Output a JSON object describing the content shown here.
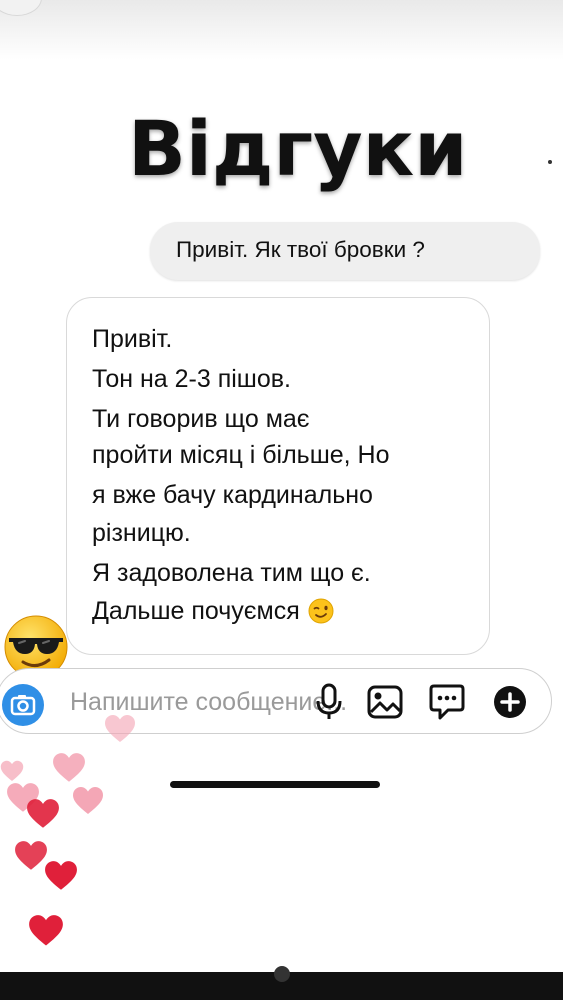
{
  "header": {
    "title": "Відгуки"
  },
  "messages": {
    "outgoing": "Привіт. Як твої бровки ?",
    "incoming_lines": [
      "Привіт.",
      "Тон на 2-3 пішов.",
      "Ти говорив що має",
      "пройти місяц і більше, Но",
      "я вже бачу кардинально",
      "різницю.",
      "Я задоволена тим що є.",
      "Дальше почуємся"
    ]
  },
  "composer": {
    "placeholder": "Напишите сообщение..."
  },
  "icons": {
    "camera": "camera-icon",
    "microphone": "microphone-icon",
    "gallery": "gallery-icon",
    "sticker": "sticker-icon",
    "add": "plus-icon",
    "reaction": "sunglasses-emoji-icon",
    "wink": "wink-emoji-icon",
    "hearts": "heart-icon"
  },
  "colors": {
    "camera_button": "#2f8fe6",
    "heart_pink": "#f4a3b3",
    "heart_red": "#e0203a"
  }
}
